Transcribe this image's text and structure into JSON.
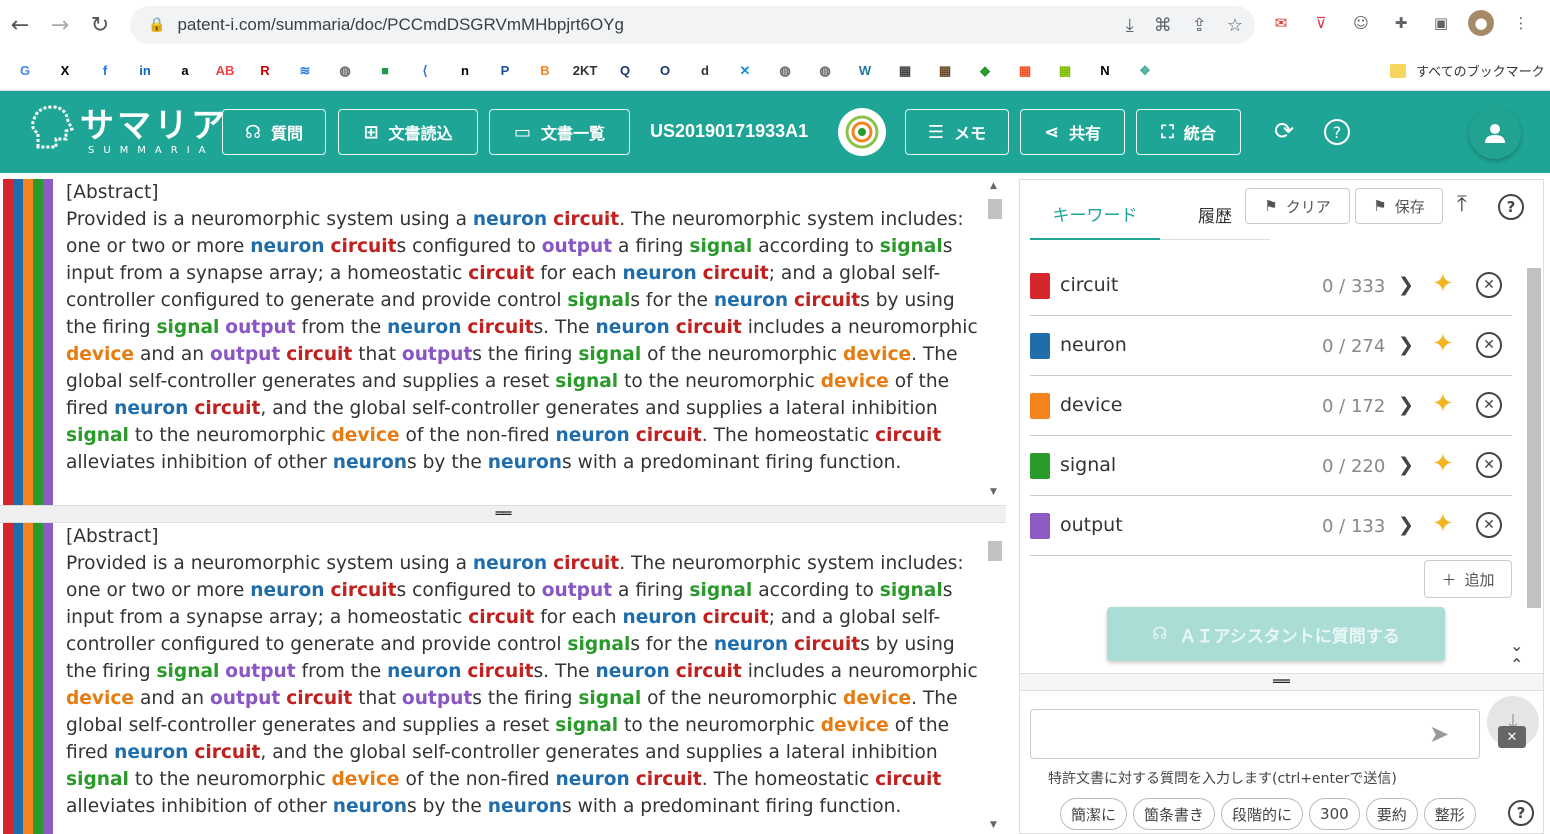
{
  "browser": {
    "url": "patent-i.com/summaria/doc/PCCmdDSGRVmMHbpjrt6OYg",
    "bookmarks_all_label": "すべてのブックマーク",
    "bookmark_icons": [
      "G",
      "X",
      "f",
      "in",
      "a",
      "AB",
      "R",
      "≋",
      "◍",
      "■",
      "⟨",
      "n",
      "P",
      "B",
      "2KT",
      "Q",
      "O",
      "d",
      "✕",
      "◍",
      "◍",
      "W",
      "▦",
      "▦",
      "◆",
      "▦",
      "▦",
      "N",
      "❖"
    ]
  },
  "app": {
    "logo_main": "サマリア",
    "logo_sub": "SUMMARIA",
    "buttons": {
      "question": "質問",
      "read_doc": "文書読込",
      "doc_list": "文書一覧",
      "memo": "メモ",
      "share": "共有",
      "merge": "統合"
    },
    "doc_id": "US20190171933A1"
  },
  "document": {
    "heading": "[Abstract]",
    "segments": [
      {
        "t": "Provided is a neuromorphic system using a ",
        "k": ""
      },
      {
        "t": "neuron",
        "k": "n"
      },
      {
        "t": " ",
        "k": ""
      },
      {
        "t": "circuit",
        "k": "c"
      },
      {
        "t": ". The neuromorphic system includes: one or two or more ",
        "k": ""
      },
      {
        "t": "neuron",
        "k": "n"
      },
      {
        "t": " ",
        "k": ""
      },
      {
        "t": "circuit",
        "k": "c"
      },
      {
        "t": "s configured to ",
        "k": ""
      },
      {
        "t": "output",
        "k": "o"
      },
      {
        "t": " a firing ",
        "k": ""
      },
      {
        "t": "signal",
        "k": "s"
      },
      {
        "t": " according to ",
        "k": ""
      },
      {
        "t": "signal",
        "k": "s"
      },
      {
        "t": "s input from a synapse array; a homeostatic ",
        "k": ""
      },
      {
        "t": "circuit",
        "k": "c"
      },
      {
        "t": " for each ",
        "k": ""
      },
      {
        "t": "neuron",
        "k": "n"
      },
      {
        "t": " ",
        "k": ""
      },
      {
        "t": "circuit",
        "k": "c"
      },
      {
        "t": "; and a global self-controller configured to generate and provide control ",
        "k": ""
      },
      {
        "t": "signal",
        "k": "s"
      },
      {
        "t": "s for the ",
        "k": ""
      },
      {
        "t": "neuron",
        "k": "n"
      },
      {
        "t": " ",
        "k": ""
      },
      {
        "t": "circuit",
        "k": "c"
      },
      {
        "t": "s by using the firing ",
        "k": ""
      },
      {
        "t": "signal",
        "k": "s"
      },
      {
        "t": " ",
        "k": ""
      },
      {
        "t": "output",
        "k": "o"
      },
      {
        "t": " from the ",
        "k": ""
      },
      {
        "t": "neuron",
        "k": "n"
      },
      {
        "t": " ",
        "k": ""
      },
      {
        "t": "circuit",
        "k": "c"
      },
      {
        "t": "s. The ",
        "k": ""
      },
      {
        "t": "neuron",
        "k": "n"
      },
      {
        "t": " ",
        "k": ""
      },
      {
        "t": "circuit",
        "k": "c"
      },
      {
        "t": " includes a neuromorphic ",
        "k": ""
      },
      {
        "t": "device",
        "k": "d"
      },
      {
        "t": " and an ",
        "k": ""
      },
      {
        "t": "output",
        "k": "o"
      },
      {
        "t": " ",
        "k": ""
      },
      {
        "t": "circuit",
        "k": "c"
      },
      {
        "t": " that ",
        "k": ""
      },
      {
        "t": "output",
        "k": "o"
      },
      {
        "t": "s the firing ",
        "k": ""
      },
      {
        "t": "signal",
        "k": "s"
      },
      {
        "t": " of the neuromorphic ",
        "k": ""
      },
      {
        "t": "device",
        "k": "d"
      },
      {
        "t": ". The global self-controller generates and supplies a reset ",
        "k": ""
      },
      {
        "t": "signal",
        "k": "s"
      },
      {
        "t": " to the neuromorphic ",
        "k": ""
      },
      {
        "t": "device",
        "k": "d"
      },
      {
        "t": " of the fired ",
        "k": ""
      },
      {
        "t": "neuron",
        "k": "n"
      },
      {
        "t": " ",
        "k": ""
      },
      {
        "t": "circuit",
        "k": "c"
      },
      {
        "t": ", and the global self-controller generates and supplies a lateral inhibition ",
        "k": ""
      },
      {
        "t": "signal",
        "k": "s"
      },
      {
        "t": " to the neuromorphic ",
        "k": ""
      },
      {
        "t": "device",
        "k": "d"
      },
      {
        "t": " of the non-fired ",
        "k": ""
      },
      {
        "t": "neuron",
        "k": "n"
      },
      {
        "t": " ",
        "k": ""
      },
      {
        "t": "circuit",
        "k": "c"
      },
      {
        "t": ". The homeostatic ",
        "k": ""
      },
      {
        "t": "circuit",
        "k": "c"
      },
      {
        "t": " alleviates inhibition of other ",
        "k": ""
      },
      {
        "t": "neuron",
        "k": "n"
      },
      {
        "t": "s by the ",
        "k": ""
      },
      {
        "t": "neuron",
        "k": "n"
      },
      {
        "t": "s with a predominant firing function.",
        "k": ""
      }
    ]
  },
  "panel": {
    "tab_keyword": "キーワード",
    "tab_history": "履歴",
    "clear_label": "クリア",
    "save_label": "保存",
    "add_label": "追加",
    "ai_button_label": "ＡＩアシスタントに質問する",
    "keywords": [
      {
        "name": "circuit",
        "count": "0 / 333",
        "color": "#d7262b"
      },
      {
        "name": "neuron",
        "count": "0 / 274",
        "color": "#1f6eab"
      },
      {
        "name": "device",
        "count": "0 / 172",
        "color": "#f5841f"
      },
      {
        "name": "signal",
        "count": "0 / 220",
        "color": "#2a9a2a"
      },
      {
        "name": "output",
        "count": "0 / 133",
        "color": "#8e5bc4"
      }
    ],
    "chat_placeholder": "",
    "chat_hint": "特許文書に対する質問を入力します(ctrl+enterで送信)",
    "chips": [
      "簡潔に",
      "箇条書き",
      "段階的に",
      "300",
      "要約",
      "整形"
    ]
  }
}
